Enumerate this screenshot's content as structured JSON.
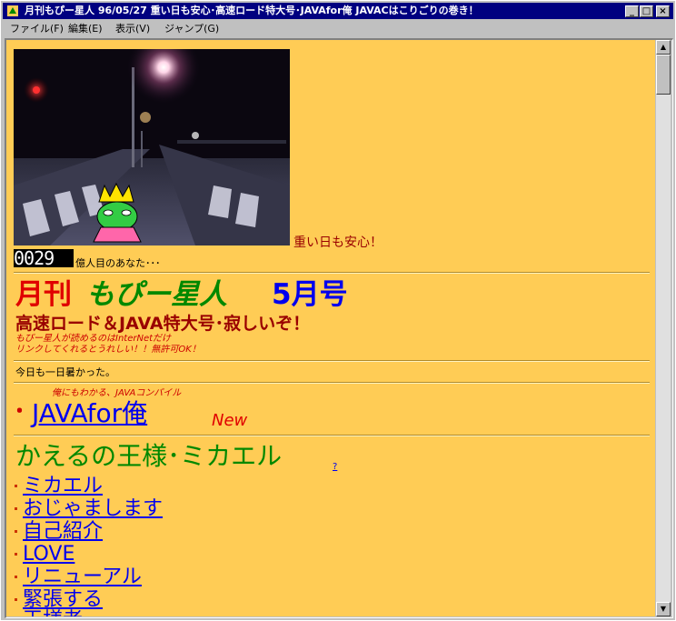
{
  "window": {
    "title": "月刊もぴー星人 96/05/27 重い日も安心･高速ロード特大号･JAVAfor俺 JAVACはこりごりの巻き！",
    "minimize": "_",
    "maximize": "□",
    "close": "×"
  },
  "menu": [
    "ファイル(F)",
    "編集(E)",
    "表示(V)",
    "ジャンプ(G)"
  ],
  "page": {
    "photo_caption": "重い日も安心！",
    "counter": "0029",
    "counter_suffix": "億人目のあなた･･･",
    "title_gekkan": "月刊",
    "title_name": "もぴー星人",
    "title_issue": "5月号",
    "subtitle": "高速ロード＆JAVA特大号･寂しいぞ！",
    "note1": "もぴー星人が読めるのはInterNetだけ",
    "note2": "リンクしてくれるとうれしい！！無許可OK！",
    "today": "今日も一日暑かった。",
    "java_caption": "俺にもわかる、JAVAコンパイル",
    "java_bullet": "･",
    "java_link": "JAVAfor俺",
    "java_new": "New",
    "section_title": "かえるの王様･ミカエル",
    "section_help": "?",
    "links": [
      "ミカエル",
      "おじゃまします",
      "自己紹介",
      "LOVE",
      "リニューアル",
      "緊張する",
      "王様者"
    ]
  },
  "colors": {
    "background": "#ffcc55",
    "title_red": "#e00000",
    "title_green": "#008800",
    "title_blue": "#0000ee",
    "subtitle": "#990000",
    "note": "#cc0000",
    "section": "#008800",
    "link": "#0000ee"
  }
}
